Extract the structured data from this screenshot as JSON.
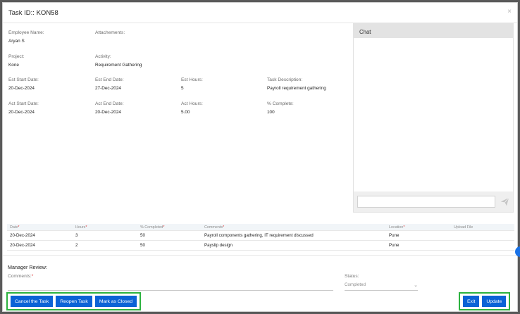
{
  "modal": {
    "title": "Task ID:: KON58",
    "close": "×"
  },
  "details": {
    "employee_name_label": "Employee Name:",
    "employee_name": "Aryan S",
    "attachments_label": "Attachements:",
    "project_label": "Project:",
    "project": "Kone",
    "activity_label": "Activity:",
    "activity": "Requirement Gathering",
    "est_start_label": "Est Start Date:",
    "est_start": "20-Dec-2024",
    "est_end_label": "Est End Date:",
    "est_end": "27-Dec-2024",
    "est_hours_label": "Est Hours:",
    "est_hours": "5",
    "task_desc_label": "Task Description:",
    "task_desc": "Payroll requirement gathering",
    "act_start_label": "Act Start Date:",
    "act_start": "20-Dec-2024",
    "act_end_label": "Act End Date:",
    "act_end": "20-Dec-2024",
    "act_hours_label": "Act Hours:",
    "act_hours": "5.00",
    "pct_complete_label": "% Complete:",
    "pct_complete": "100"
  },
  "chat": {
    "title": "Chat",
    "placeholder": ""
  },
  "grid": {
    "headers": {
      "date": "Date",
      "hours": "Hours",
      "completed": "% Completed",
      "comments": "Comments",
      "location": "Location",
      "upload": "Upload File"
    },
    "rows": [
      {
        "date": "20-Dec-2024",
        "hours": "3",
        "completed": "50",
        "comments": "Payroll components gathering, IT requirement discussed",
        "location": "Pune"
      },
      {
        "date": "20-Dec-2024",
        "hours": "2",
        "completed": "50",
        "comments": "Payslip design",
        "location": "Pune"
      }
    ]
  },
  "review": {
    "title": "Manager Review:",
    "comments_label": "Comments:",
    "comments_value": "",
    "status_label": "Status:",
    "status_value": "Completed"
  },
  "buttons": {
    "cancel_task": "Cancel the Task",
    "reopen_task": "Reopen Task",
    "mark_closed": "Mark as Closed",
    "exit": "Exit",
    "update": "Update"
  },
  "colors": {
    "primary": "#0b63d6",
    "highlight_border": "#2cb23f",
    "required": "#d33333"
  }
}
